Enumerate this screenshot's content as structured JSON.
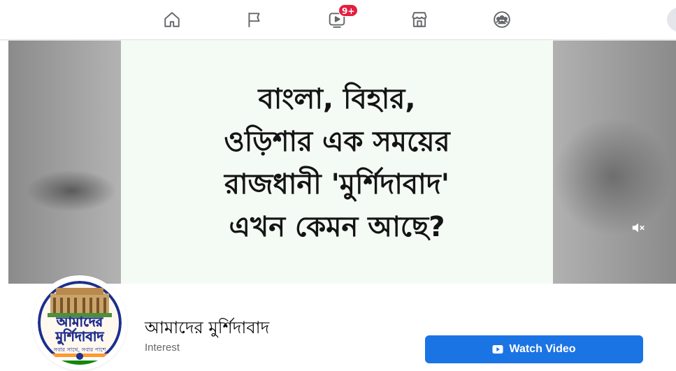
{
  "nav": {
    "items": [
      {
        "name": "home-icon"
      },
      {
        "name": "flag-icon"
      },
      {
        "name": "watch-icon",
        "badge": "9+"
      },
      {
        "name": "marketplace-icon"
      },
      {
        "name": "groups-icon"
      }
    ],
    "badge_color": "#e41e3f"
  },
  "cover": {
    "headline_lines": [
      "বাংলা, বিহার,",
      "ওড়িশার এক সময়ের",
      "রাজধানী 'মুর্শিদাবাদ'",
      "এখন কেমন আছে?"
    ],
    "mute_icon": "speaker-muted-icon"
  },
  "page": {
    "name": "আমাদের মুর্শিদাবাদ",
    "category": "Interest",
    "logo": {
      "title_line1": "আমাদের",
      "title_line2": "মুর্শিদাবাদ",
      "tagline": "সবার সাথে, সবার পাশে"
    }
  },
  "cta": {
    "label": "Watch Video",
    "icon": "video-play-icon",
    "color": "#1b74e4"
  }
}
